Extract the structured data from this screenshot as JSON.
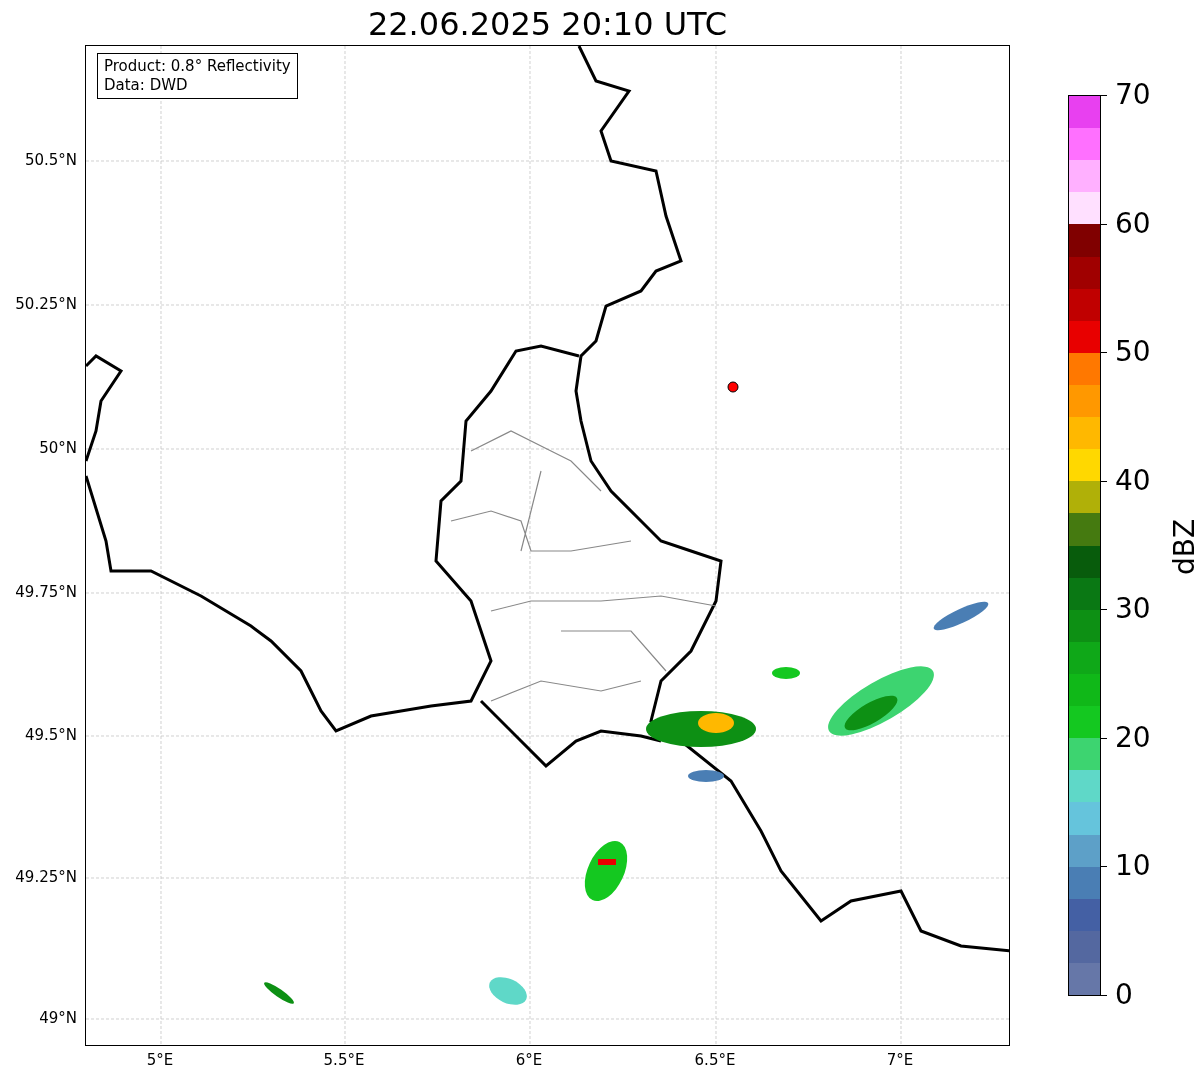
{
  "title": "22.06.2025 20:10 UTC",
  "legend": {
    "lines": [
      "Product: 0.8° Reflectivity",
      "Data: DWD"
    ]
  },
  "y_axis": {
    "ticks": [
      "50.5°N",
      "50.25°N",
      "50°N",
      "49.75°N",
      "49.5°N",
      "49.25°N",
      "49°N"
    ]
  },
  "x_axis": {
    "ticks": [
      "5°E",
      "5.5°E",
      "6°E",
      "6.5°E",
      "7°E"
    ]
  },
  "colorbar": {
    "label": "dBZ",
    "ticks": [
      "70",
      "60",
      "50",
      "40",
      "30",
      "20",
      "10",
      "0"
    ],
    "segments": [
      {
        "color": "#e840f0"
      },
      {
        "color": "#ff70ff"
      },
      {
        "color": "#ffb0ff"
      },
      {
        "color": "#ffe0ff"
      },
      {
        "color": "#800000"
      },
      {
        "color": "#a00000"
      },
      {
        "color": "#c00000"
      },
      {
        "color": "#e80000"
      },
      {
        "color": "#ff7800"
      },
      {
        "color": "#ff9800"
      },
      {
        "color": "#ffb800"
      },
      {
        "color": "#ffd800"
      },
      {
        "color": "#b0b008"
      },
      {
        "color": "#457a10"
      },
      {
        "color": "#085c0c"
      },
      {
        "color": "#0a7814"
      },
      {
        "color": "#0d9014"
      },
      {
        "color": "#0fa818"
      },
      {
        "color": "#10b818"
      },
      {
        "color": "#14c820"
      },
      {
        "color": "#3dd470"
      },
      {
        "color": "#5fd8c8"
      },
      {
        "color": "#65c4dc"
      },
      {
        "color": "#5da0c8"
      },
      {
        "color": "#4a7eb4"
      },
      {
        "color": "#4460a4"
      },
      {
        "color": "#5468a0"
      },
      {
        "color": "#6677a8"
      }
    ]
  }
}
